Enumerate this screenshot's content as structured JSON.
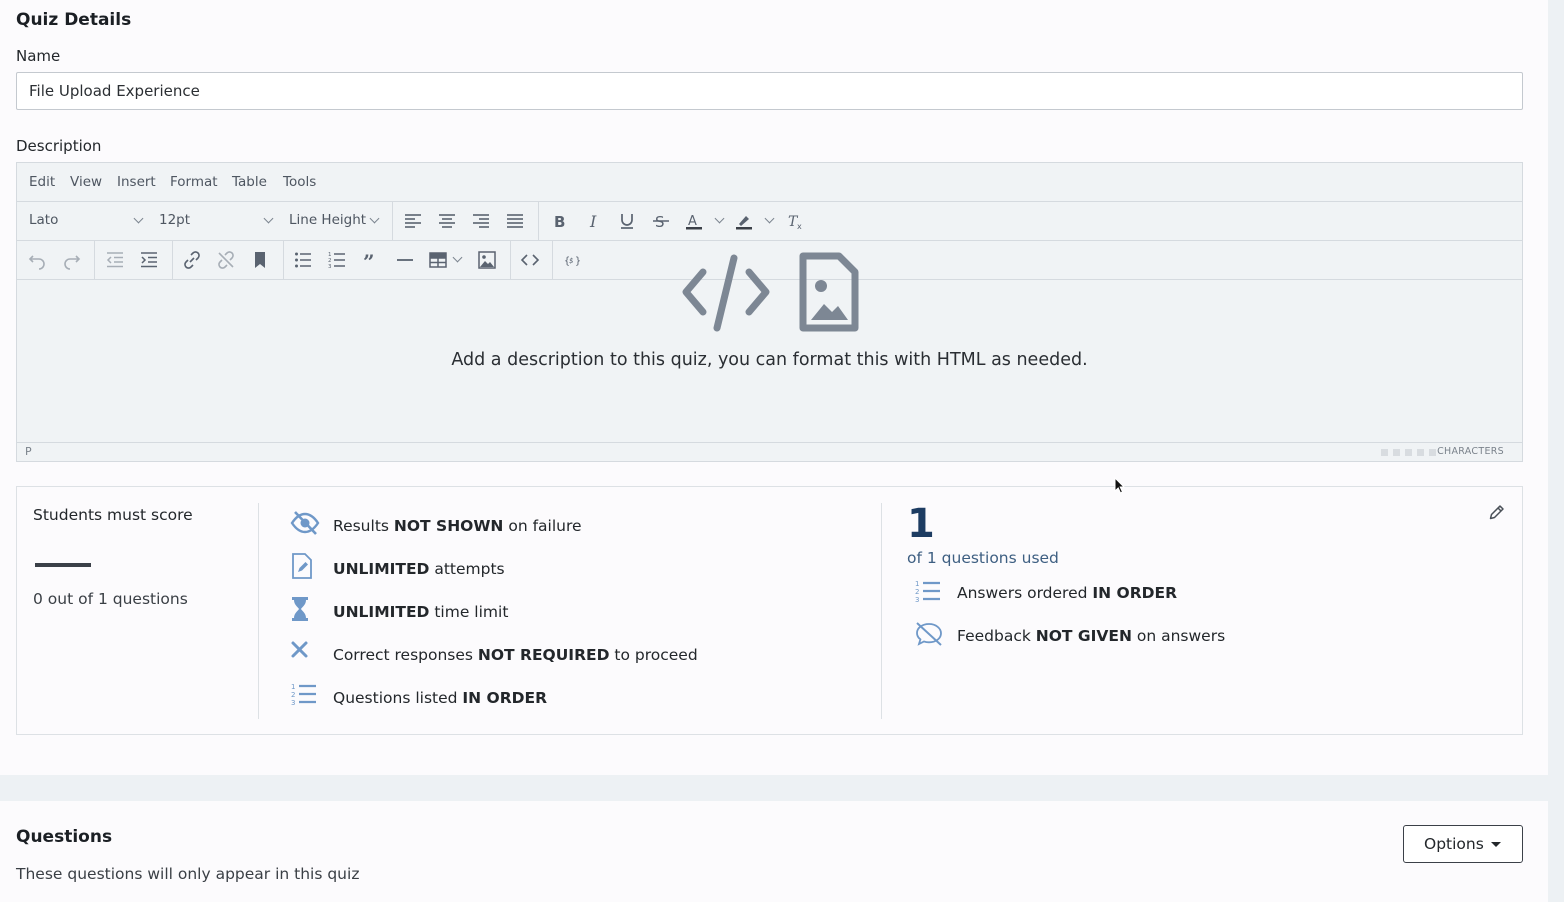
{
  "quiz_details": {
    "title": "Quiz Details",
    "name_label": "Name",
    "name_value": "File Upload Experience",
    "description_label": "Description"
  },
  "editor": {
    "menu": [
      "Edit",
      "View",
      "Insert",
      "Format",
      "Table",
      "Tools"
    ],
    "font_family": "Lato",
    "font_size": "12pt",
    "line_height": "Line Height",
    "placeholder": "Add a description to this quiz, you can format this with HTML as needed.",
    "status_path": "P",
    "status_chars": "CHARACTERS"
  },
  "summary": {
    "must_score_label": "Students must score",
    "score_text": "0 out of 1 questions",
    "features_left": [
      {
        "icon": "eye-slash-icon",
        "pre": "Results ",
        "bold": "NOT SHOWN",
        "post": " on failure"
      },
      {
        "icon": "document-pencil-icon",
        "pre": "",
        "bold": "UNLIMITED",
        "post": " attempts"
      },
      {
        "icon": "hourglass-icon",
        "pre": "",
        "bold": "UNLIMITED",
        "post": " time limit"
      },
      {
        "icon": "x-mark-icon",
        "pre": "Correct responses ",
        "bold": "NOT REQUIRED",
        "post": " to proceed"
      },
      {
        "icon": "ordered-list-icon",
        "pre": "Questions listed ",
        "bold": "IN ORDER",
        "post": ""
      }
    ],
    "questions_used_count": "1",
    "questions_used_text": "of 1 questions used",
    "features_right": [
      {
        "icon": "ordered-list-icon",
        "pre": "Answers ordered ",
        "bold": "IN ORDER",
        "post": ""
      },
      {
        "icon": "comment-slash-icon",
        "pre": "Feedback ",
        "bold": "NOT GIVEN",
        "post": " on answers"
      }
    ]
  },
  "questions": {
    "title": "Questions",
    "subtitle": "These questions will only appear in this quiz",
    "options_label": "Options"
  },
  "colors": {
    "accent": "#1d3c62",
    "icon_blue": "#6f98c8",
    "toolbar_icon": "#5a6370"
  }
}
